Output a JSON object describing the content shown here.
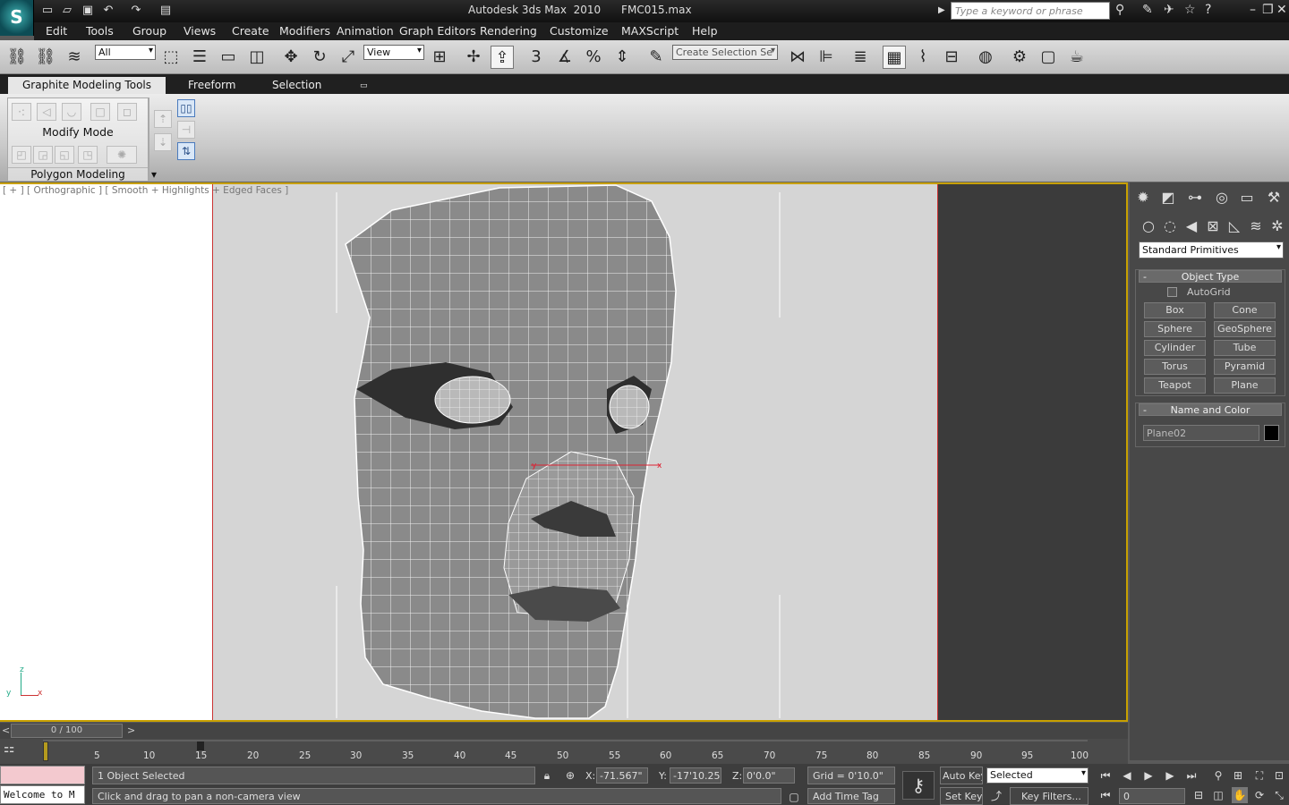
{
  "app": {
    "title": "Autodesk 3ds Max  2010      FMC015.max",
    "search_placeholder": "Type a keyword or phrase"
  },
  "menu": [
    "Edit",
    "Tools",
    "Group",
    "Views",
    "Create",
    "Modifiers",
    "Animation",
    "Graph Editors",
    "Rendering",
    "Customize",
    "MAXScript",
    "Help"
  ],
  "toolbar": {
    "selection_filter": "All",
    "ref_coord": "View",
    "named_selection": "Create Selection Se"
  },
  "ribbon": {
    "tabs": [
      "Graphite Modeling Tools",
      "Freeform",
      "Selection"
    ],
    "panel_mode": "Modify Mode",
    "panel_footer": "Polygon Modeling"
  },
  "viewport": {
    "label": "[ + ] [ Orthographic ] [ Smooth + Highlights + Edged Faces ]",
    "axis_z": "z",
    "axis_x": "x",
    "axis_y": "y",
    "gizmo_x": "x",
    "gizmo_y": "y"
  },
  "command_panel": {
    "category": "Standard Primitives",
    "object_type_title": "Object Type",
    "autogrid": "AutoGrid",
    "buttons": [
      "Box",
      "Cone",
      "Sphere",
      "GeoSphere",
      "Cylinder",
      "Tube",
      "Torus",
      "Pyramid",
      "Teapot",
      "Plane"
    ],
    "name_color_title": "Name and Color",
    "object_name": "Plane02",
    "object_color": "#000000",
    "rollout_minus": "-"
  },
  "timeline": {
    "frame": "0 / 100",
    "prev": "<",
    "next": ">",
    "ticks": [
      "5",
      "10",
      "15",
      "20",
      "25",
      "30",
      "35",
      "40",
      "45",
      "50",
      "55",
      "60",
      "65",
      "70",
      "75",
      "80",
      "85",
      "90",
      "95",
      "100"
    ]
  },
  "status": {
    "maxscript": "Welcome to M",
    "selected": "1 Object Selected",
    "prompt": "Click and drag to pan a non-camera view",
    "x_label": "X:",
    "x_value": "-71.567\"",
    "y_label": "Y:",
    "y_value": "-17'10.25\"",
    "z_label": "Z:",
    "z_value": "0'0.0\"",
    "grid": "Grid = 0'10.0\"",
    "add_time_tag": "Add Time Tag",
    "auto_key": "Auto Key",
    "set_key": "Set Key",
    "key_mode": "Selected",
    "key_filters": "Key Filters...",
    "current_frame": "0"
  }
}
